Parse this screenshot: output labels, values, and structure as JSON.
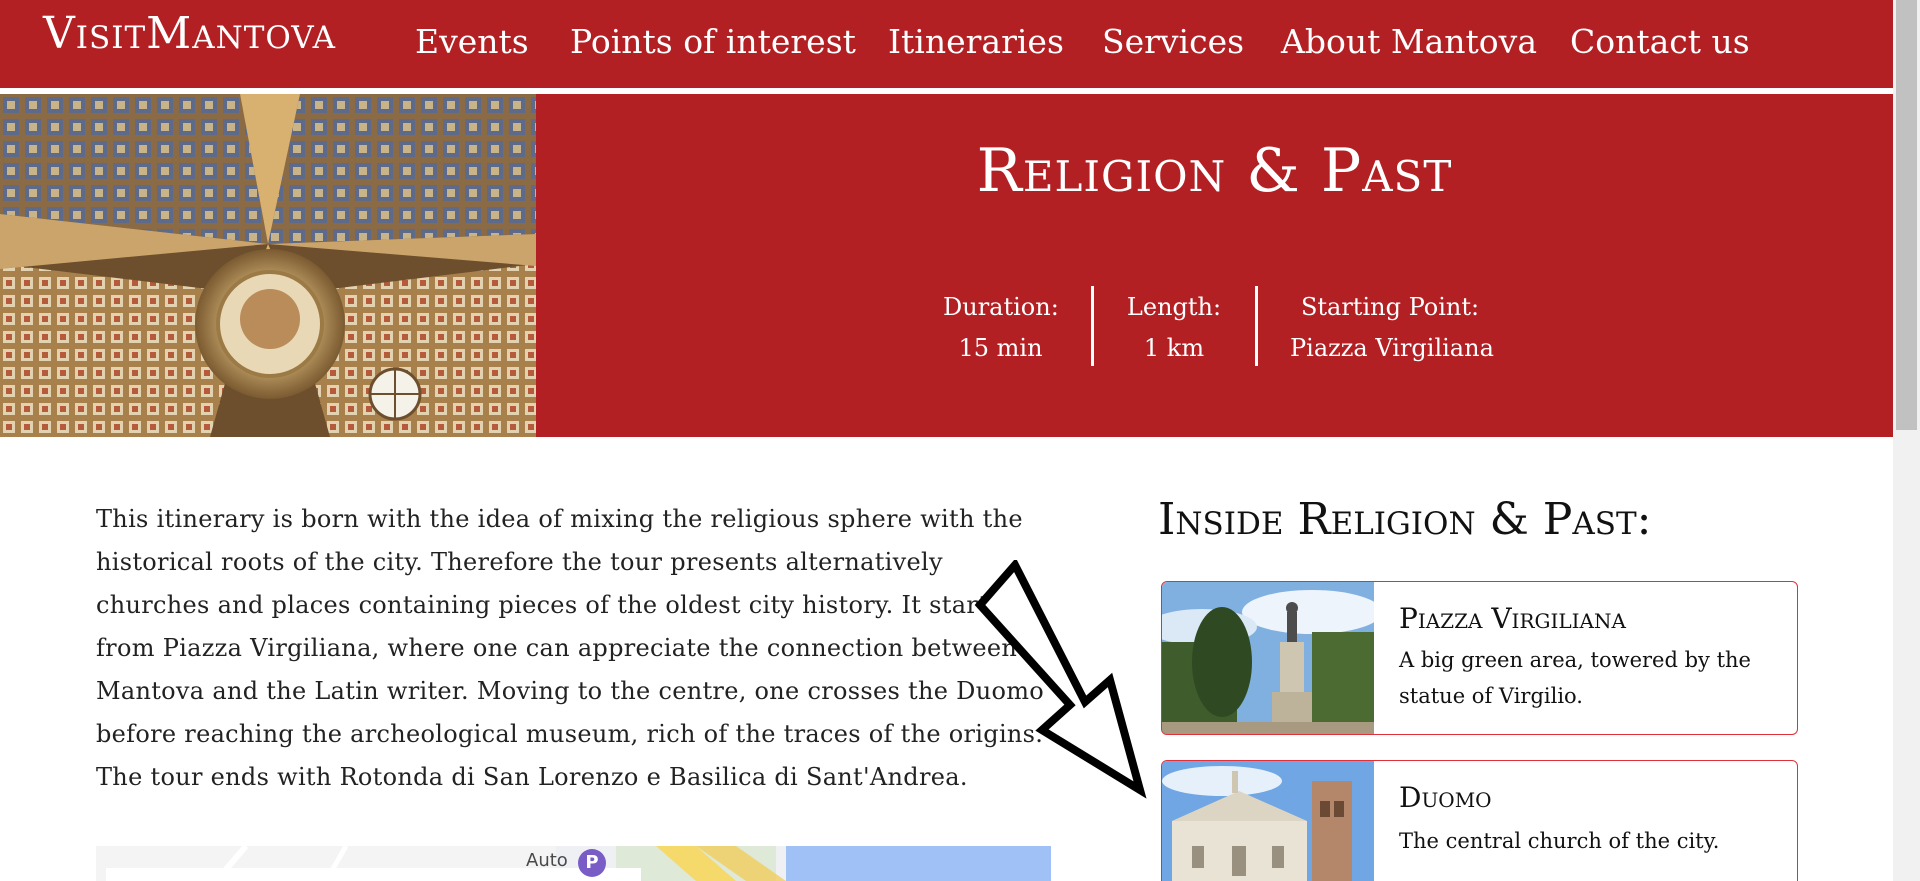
{
  "nav": {
    "logo": "VisitMantova",
    "links": [
      "Events",
      "Points of interest",
      "Itineraries",
      "Services",
      "About Mantova",
      "Contact us"
    ]
  },
  "hero": {
    "title": "Religion & Past",
    "stats": [
      {
        "label": "Duration:",
        "value": "15 min"
      },
      {
        "label": "Length:",
        "value": "1 km"
      },
      {
        "label": "Starting Point:",
        "value": "Piazza Virgiliana"
      }
    ]
  },
  "intro": {
    "text": "This itinerary is born with the idea of mixing the religious sphere with the historical roots of the city. Therefore the tour presents alternatively churches and places containing pieces of the oldest city history. It starts from Piazza Virgiliana, where one can appreciate the connection between Mantova and the Latin writer. Moving to the centre, one crosses the Duomo before reaching the archeological museum, rich of the traces of the origins. The tour ends with Rotonda di San Lorenzo e Basilica di Sant'Andrea."
  },
  "map": {
    "snippet_text": "Auto"
  },
  "sidebar": {
    "title": "Inside Religion & Past:",
    "cards": [
      {
        "title": "Piazza Virgiliana",
        "description": "A big green area, towered by the statue of Virgilio."
      },
      {
        "title": "Duomo",
        "description": "The central church of the city."
      }
    ]
  },
  "colors": {
    "brand_red": "#b22024",
    "card_border": "#e0303a",
    "white": "#ffffff"
  },
  "icons": [
    "hero-ceiling-image",
    "piazza-virgiliana-thumbnail",
    "duomo-thumbnail",
    "map-parking-icon",
    "annotation-arrow"
  ]
}
